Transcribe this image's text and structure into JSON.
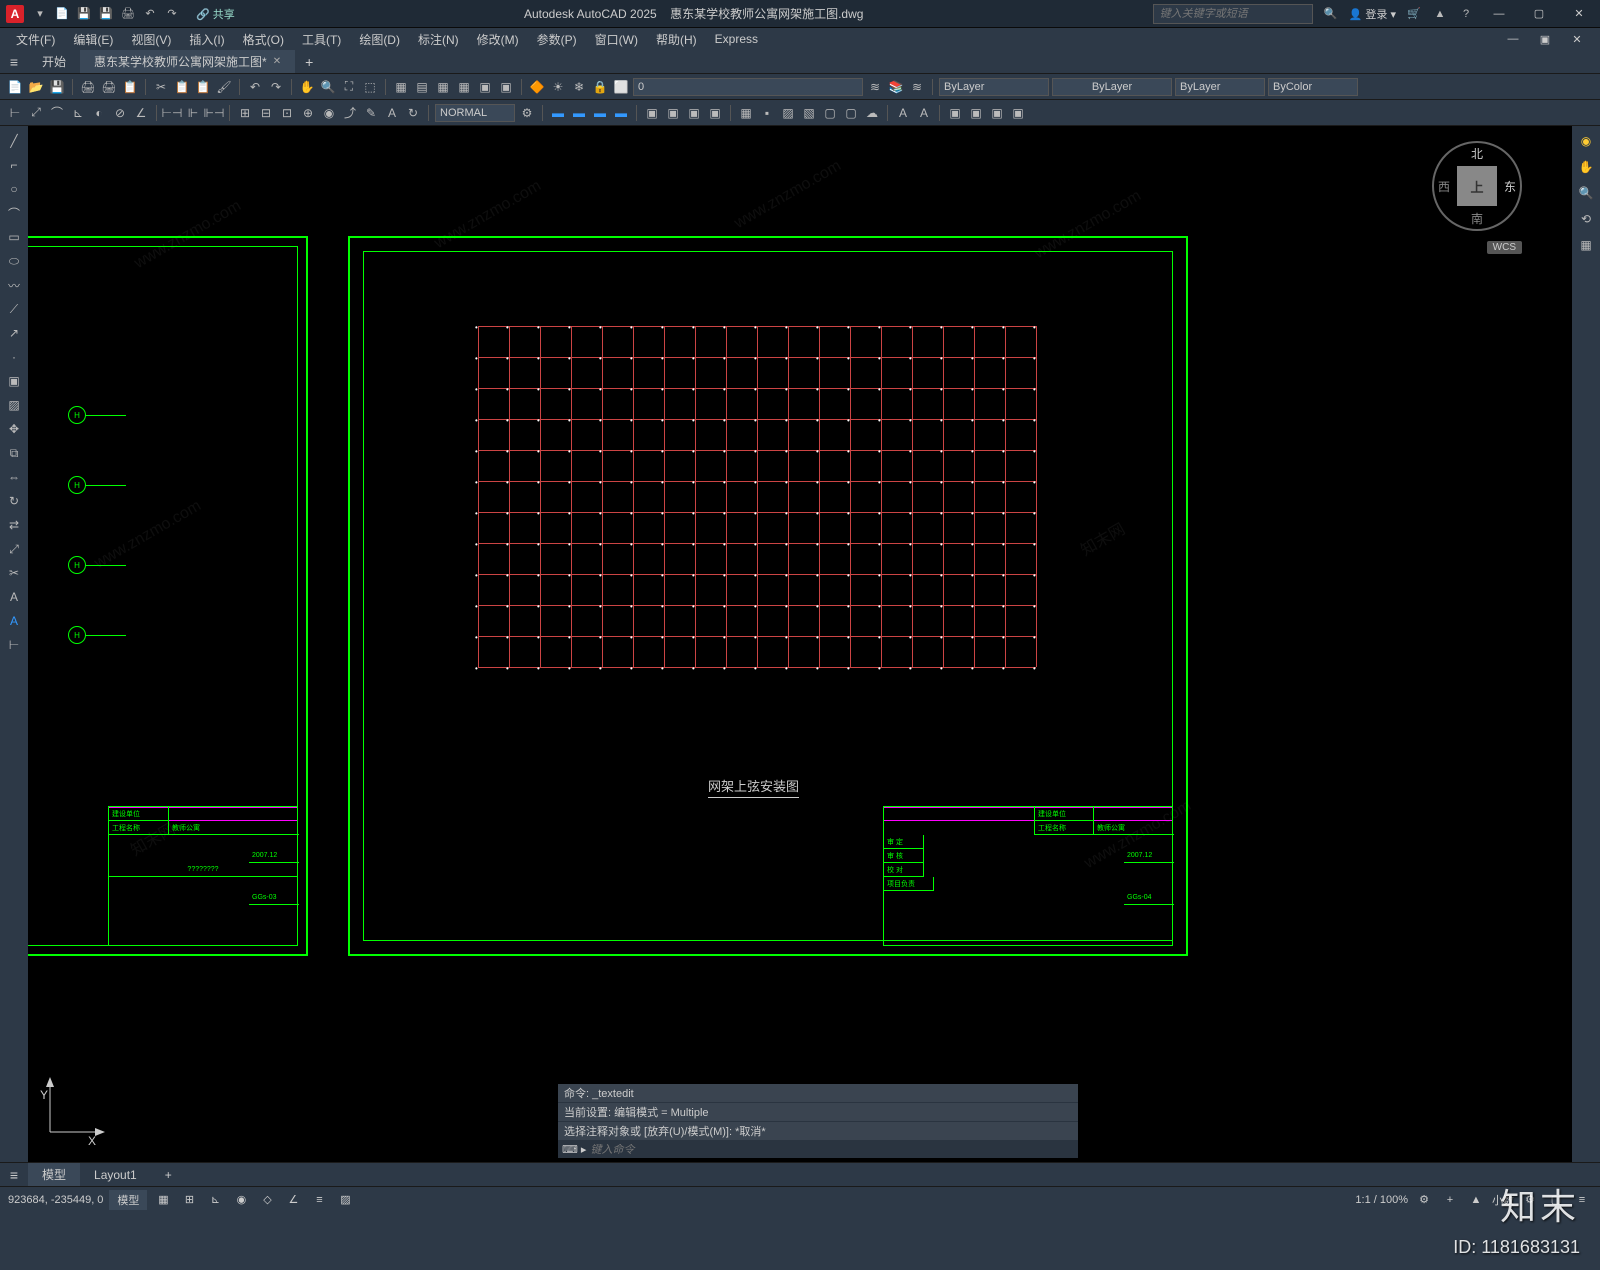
{
  "app": {
    "name": "Autodesk AutoCAD 2025",
    "document": "惠东某学校教师公寓网架施工图.dwg",
    "icon_letter": "A",
    "share_label": "共享",
    "search_placeholder": "键入关键字或短语",
    "login_label": "登录"
  },
  "menus": [
    "文件(F)",
    "编辑(E)",
    "视图(V)",
    "插入(I)",
    "格式(O)",
    "工具(T)",
    "绘图(D)",
    "标注(N)",
    "修改(M)",
    "参数(P)",
    "窗口(W)",
    "帮助(H)",
    "Express"
  ],
  "file_tabs": {
    "start": "开始",
    "active": "惠东某学校教师公寓网架施工图*"
  },
  "layer_controls": {
    "layer_value": "0",
    "linetype_layer": "ByLayer",
    "lineweight_layer": "ByLayer",
    "linetype2": "ByLayer",
    "color": "ByColor"
  },
  "style_dropdown": "NORMAL",
  "viewcube": {
    "top": "上",
    "n": "北",
    "s": "南",
    "e": "东",
    "w": "西",
    "wcs": "WCS"
  },
  "ucs": {
    "x": "X",
    "y": "Y"
  },
  "drawing": {
    "title": "网架上弦安装图",
    "axis_labels": [
      "H",
      "H",
      "H",
      "H"
    ],
    "titleblock_left": {
      "row1": "建设单位",
      "row2": "工程名称",
      "row2v": "教师公寓",
      "q": "????????",
      "date": "2007.12",
      "sheet": "GGs-03"
    },
    "titleblock_right": {
      "row1": "建设单位",
      "row2": "工程名称",
      "row2v": "教师公寓",
      "date": "2007.12",
      "sheet": "GGs-04"
    }
  },
  "command": {
    "line1": "命令: _textedit",
    "line2": "当前设置: 编辑模式 = Multiple",
    "line3": "选择注释对象或 [放弃(U)/模式(M)]: *取消*",
    "prompt_placeholder": "键入命令"
  },
  "bottom_tabs": [
    "模型",
    "Layout1"
  ],
  "status": {
    "coords": "923684, -235449, 0",
    "model": "模型",
    "scale": "1:1 / 100%",
    "decimal": "小数"
  },
  "watermark": {
    "brand": "知末",
    "id": "ID: 1181683131"
  }
}
